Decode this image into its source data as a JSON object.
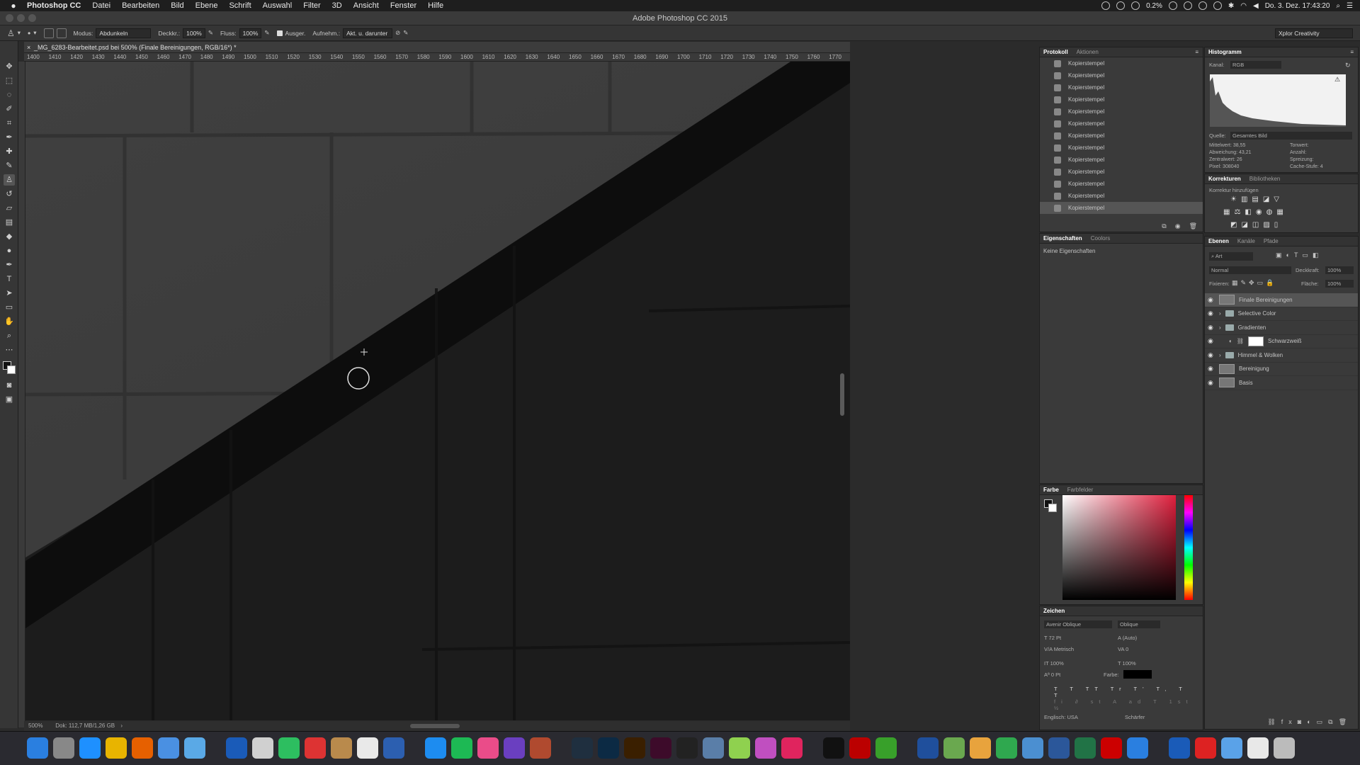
{
  "menubar": {
    "app_name": "Photoshop CC",
    "items": [
      "Datei",
      "Bearbeiten",
      "Bild",
      "Ebene",
      "Schrift",
      "Auswahl",
      "Filter",
      "3D",
      "Ansicht",
      "Fenster",
      "Hilfe"
    ],
    "battery": "0.2%",
    "datetime": "Do. 3. Dez.  17:43:20"
  },
  "window": {
    "title": "Adobe Photoshop CC 2015"
  },
  "optionsbar": {
    "modus_label": "Modus:",
    "modus_value": "Abdunkeln",
    "deckkr_label": "Deckkr.:",
    "deckkr_value": "100%",
    "fluss_label": "Fluss:",
    "fluss_value": "100%",
    "ausger_label": "Ausger.",
    "aufnehm_label": "Aufnehm.:",
    "aufnehm_value": "Akt. u. darunter",
    "workspace": "Xplor Creativity"
  },
  "document": {
    "tab_title": "_MG_6283-Bearbeitet.psd bei 500% (Finale Bereinigungen, RGB/16*) *",
    "zoom": "500%",
    "doc_size": "Dok: 112,7 MB/1,26 GB",
    "ruler_ticks": [
      "1400",
      "1410",
      "1420",
      "1430",
      "1440",
      "1450",
      "1460",
      "1470",
      "1480",
      "1490",
      "1500",
      "1510",
      "1520",
      "1530",
      "1540",
      "1550",
      "1560",
      "1570",
      "1580",
      "1590",
      "1600",
      "1610",
      "1620",
      "1630",
      "1640",
      "1650",
      "1660",
      "1670",
      "1680",
      "1690",
      "1700",
      "1710",
      "1720",
      "1730",
      "1740",
      "1750",
      "1760",
      "1770"
    ]
  },
  "protokoll": {
    "tabs": [
      "Protokoll",
      "Aktionen"
    ],
    "items": [
      "Kopierstempel",
      "Kopierstempel",
      "Kopierstempel",
      "Kopierstempel",
      "Kopierstempel",
      "Kopierstempel",
      "Kopierstempel",
      "Kopierstempel",
      "Kopierstempel",
      "Kopierstempel",
      "Kopierstempel",
      "Kopierstempel",
      "Kopierstempel"
    ]
  },
  "eigenschaften": {
    "tabs": [
      "Eigenschaften",
      "Coolors"
    ],
    "empty_text": "Keine Eigenschaften"
  },
  "histogramm": {
    "title": "Histogramm",
    "kanal_label": "Kanal:",
    "kanal_value": "RGB",
    "quelle_label": "Quelle:",
    "quelle_value": "Gesamtes Bild",
    "stats": {
      "mittelwert": "Mittelwert: 38,55",
      "abweichung": "Abweichung: 43,21",
      "zentralwert": "Zentralwert: 26",
      "pixel": "Pixel: 308040",
      "tonwert": "Tonwert:",
      "anzahl": "Anzahl:",
      "spreizung": "Spreizung:",
      "cache": "Cache-Stufe: 4"
    }
  },
  "korrekturen": {
    "tabs": [
      "Korrekturen",
      "Bibliotheken"
    ],
    "add_label": "Korrektur hinzufügen"
  },
  "ebenen": {
    "tabs": [
      "Ebenen",
      "Kanäle",
      "Pfade"
    ],
    "filter": "Art",
    "blend": "Normal",
    "deckkraft_label": "Deckkraft:",
    "deckkraft_value": "100%",
    "fixieren_label": "Fixieren:",
    "flaeche_label": "Fläche:",
    "flaeche_value": "100%",
    "layers": [
      {
        "name": "Finale Bereinigungen",
        "kind": "layer"
      },
      {
        "name": "Selective Color",
        "kind": "folder"
      },
      {
        "name": "Gradienten",
        "kind": "folder"
      },
      {
        "name": "Schwarzweiß",
        "kind": "adjustment"
      },
      {
        "name": "Himmel & Wolken",
        "kind": "folder"
      },
      {
        "name": "Bereinigung",
        "kind": "layer"
      },
      {
        "name": "Basis",
        "kind": "layer"
      }
    ]
  },
  "farbe": {
    "tabs": [
      "Farbe",
      "Farbfelder"
    ]
  },
  "zeichen": {
    "title": "Zeichen",
    "font": "Avenir Oblique",
    "style": "Oblique",
    "size": "72 Pt",
    "leading": "(Auto)",
    "kerning": "Metrisch",
    "tracking": "0",
    "vscale": "100%",
    "hscale": "100%",
    "baseline": "0 Pt",
    "farbe_label": "Farbe:",
    "language": "Englisch: USA",
    "aa": "Schärfer"
  },
  "colors": {
    "panel_bg": "#3a3a3a",
    "canvas_dark": "#141414",
    "accent_red": "#e01f3d"
  }
}
